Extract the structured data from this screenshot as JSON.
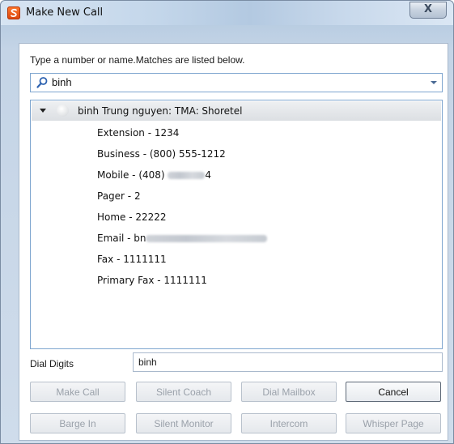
{
  "window": {
    "title": "Make New Call",
    "close_glyph": "X"
  },
  "search": {
    "prompt": "Type a number or name.Matches are listed below.",
    "value": "binh"
  },
  "contact": {
    "name": "binh Trung nguyen: TMA: Shoretel",
    "details": [
      {
        "text": "Extension - 1234"
      },
      {
        "text": "Business - (800) 555-1212"
      },
      {
        "text": "Mobile - (408) ",
        "suffix": "4",
        "redacted": true
      },
      {
        "text": "Pager - 2"
      },
      {
        "text": "Home - 22222"
      },
      {
        "text": "Email - bn",
        "suffix": "",
        "redacted": true
      },
      {
        "text": "Fax - 1111111"
      },
      {
        "text": "Primary Fax - 1111111"
      }
    ]
  },
  "dial": {
    "label": "Dial Digits",
    "value": "binh"
  },
  "buttons": {
    "make_call": "Make Call",
    "silent_coach": "Silent Coach",
    "dial_mailbox": "Dial Mailbox",
    "cancel": "Cancel",
    "barge_in": "Barge In",
    "silent_monitor": "Silent Monitor",
    "intercom": "Intercom",
    "whisper_page": "Whisper Page"
  },
  "icons": {
    "app": "shoretel-app-icon",
    "search": "search-icon",
    "dropdown": "chevron-down-icon",
    "expand": "expand-arrow-icon",
    "presence": "presence-icon"
  },
  "colors": {
    "app_icon": "#e8581a",
    "focus_border": "#7fa6cf",
    "disabled_text": "#9aa1aa"
  }
}
